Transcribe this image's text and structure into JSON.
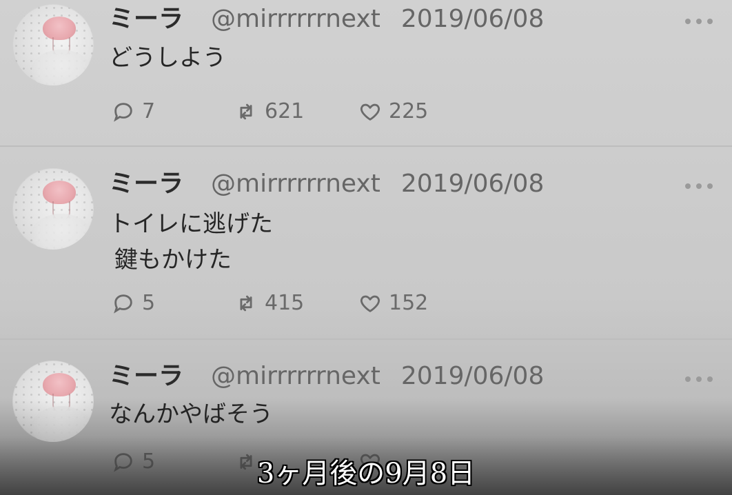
{
  "timeline": {
    "tweets": [
      {
        "display_name": "ミーラ",
        "handle": "@mirrrrrrnext",
        "date": "2019/06/08",
        "text_lines": [
          "どうしよう"
        ],
        "replies": "7",
        "retweets": "621",
        "likes": "225"
      },
      {
        "display_name": "ミーラ",
        "handle": "@mirrrrrrnext",
        "date": "2019/06/08",
        "text_lines": [
          "トイレに逃げた",
          "鍵もかけた"
        ],
        "replies": "5",
        "retweets": "415",
        "likes": "152"
      },
      {
        "display_name": "ミーラ",
        "handle": "@mirrrrrrnext",
        "date": "2019/06/08",
        "text_lines": [
          "なんかやばそう"
        ],
        "replies": "5",
        "retweets": "",
        "likes": ""
      }
    ]
  },
  "subtitle": {
    "text": "3ヶ月後の9月8日"
  },
  "icons": {
    "reply": "reply-icon",
    "retweet": "retweet-icon",
    "like": "heart-icon",
    "more": "more-icon"
  },
  "colors": {
    "background": "#c9c9c9",
    "text_primary": "#2b2b2b",
    "text_secondary": "#666666",
    "action_gray": "#6a6a6a",
    "subtitle": "#ffffff"
  }
}
